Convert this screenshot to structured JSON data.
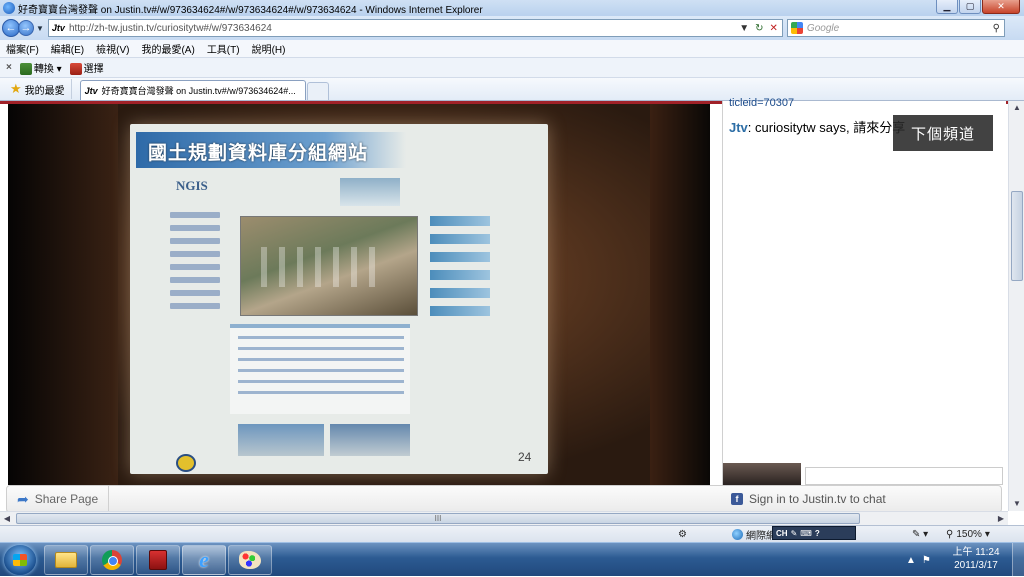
{
  "window": {
    "title": "好奇寶寶台灣發聲 on Justin.tv#/w/973634624#/w/973634624#/w/973634624 - Windows Internet Explorer",
    "minimize": "▁",
    "maximize": "▢",
    "close": "✕"
  },
  "address": {
    "favicon_text": "Jtv",
    "url": "http://zh-tw.justin.tv/curiositytw#/w/973634624",
    "search_placeholder": "Google"
  },
  "menu": [
    "檔案(F)",
    "編輯(E)",
    "檢視(V)",
    "我的最愛(A)",
    "工具(T)",
    "說明(H)"
  ],
  "toolbar": {
    "close": "×",
    "translate": "轉換",
    "select": "選擇"
  },
  "favorites": {
    "label": "我的最愛",
    "tab_icon_text": "Jtv",
    "tab_title": "好奇寶寶台灣發聲 on Justin.tv#/w/973634624#..."
  },
  "video": {
    "slide_title": "國土規劃資料庫分組網站",
    "slide_logo": "NGIS",
    "slide_page": "24"
  },
  "chat": {
    "clipped_text": "ticleid=70307",
    "user": "Jtv",
    "message": ": curiositytw says, 請來分享",
    "next_channel": "下個頻道"
  },
  "bottom_bar": {
    "share_label": "Share Page",
    "signin_label": "Sign in to Justin.tv to chat",
    "signin_icon": "f"
  },
  "scroll": {
    "h_grip": "III"
  },
  "status": {
    "zone": "網際網路",
    "ime_label": "CH",
    "zoom": "150%"
  },
  "taskbar": {
    "time": "上午 11:24",
    "date": "2011/3/17"
  },
  "icons": {
    "back": "back-arrow-icon",
    "forward": "forward-arrow-icon",
    "refresh": "refresh-icon",
    "stop": "stop-icon",
    "search": "search-icon",
    "star": "favorites-star-icon",
    "share": "share-icon"
  }
}
